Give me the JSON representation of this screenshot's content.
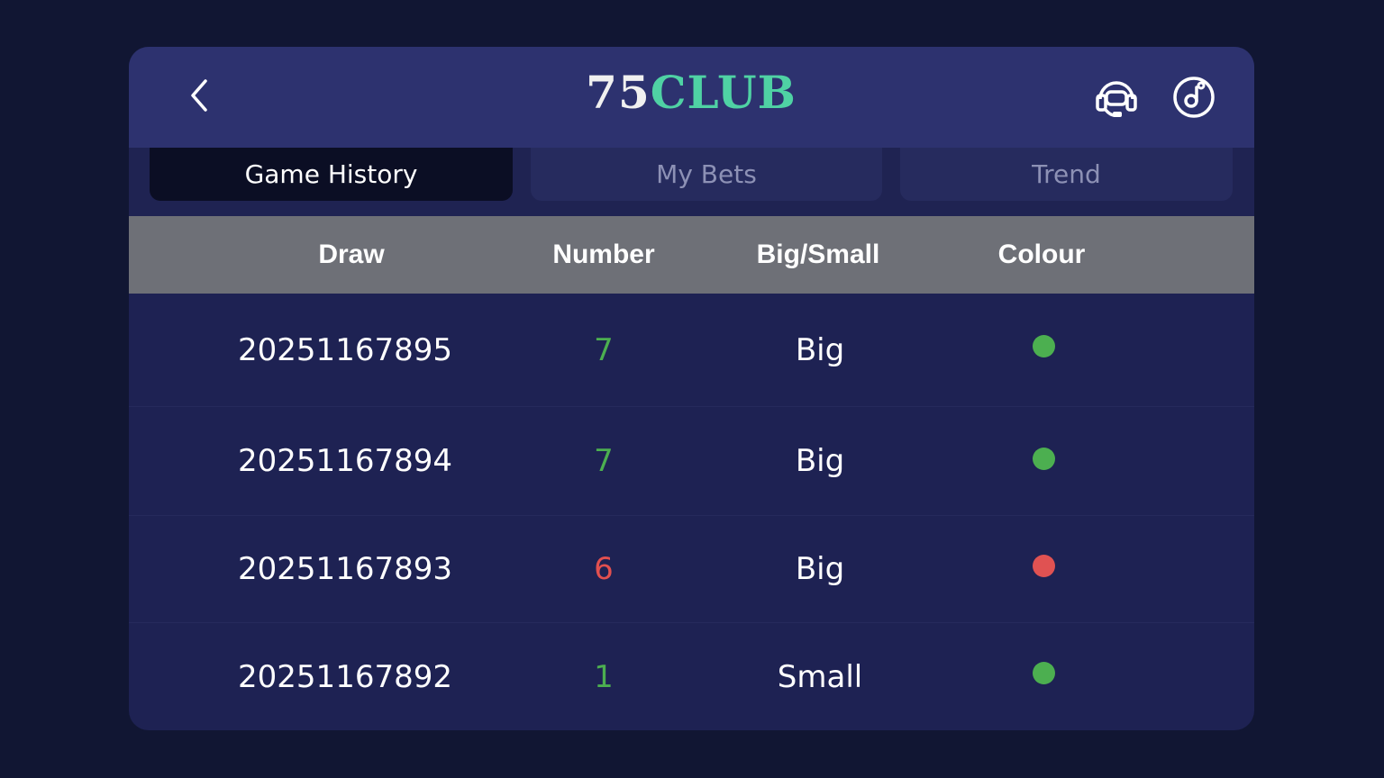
{
  "header": {
    "logo_number": "75",
    "logo_word": "CLUB"
  },
  "tabs": [
    {
      "label": "Game History",
      "active": true
    },
    {
      "label": "My Bets",
      "active": false
    },
    {
      "label": "Trend",
      "active": false
    }
  ],
  "table": {
    "columns": [
      "Draw",
      "Number",
      "Big/Small",
      "Colour"
    ],
    "rows": [
      {
        "draw": "20251167895",
        "number": "7",
        "size": "Big",
        "colour": "green"
      },
      {
        "draw": "20251167894",
        "number": "7",
        "size": "Big",
        "colour": "green"
      },
      {
        "draw": "20251167893",
        "number": "6",
        "size": "Big",
        "colour": "red"
      },
      {
        "draw": "20251167892",
        "number": "1",
        "size": "Small",
        "colour": "green"
      }
    ]
  },
  "icons": {
    "back": "chevron-left-icon",
    "support": "headset-icon",
    "music": "music-note-icon"
  },
  "colors": {
    "green": "#4caf50",
    "red": "#e05252",
    "accent": "#4fd2a4"
  }
}
